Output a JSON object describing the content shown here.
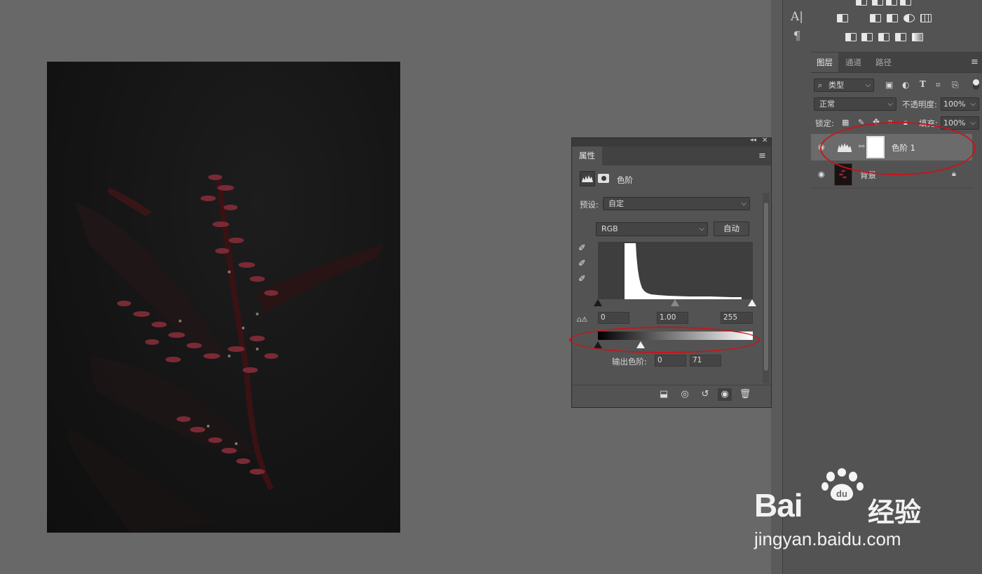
{
  "dock_strip": {
    "icon_1": "A|",
    "icon_2": "¶"
  },
  "layers_panel": {
    "tabs": [
      "图层",
      "通道",
      "路径"
    ],
    "filter": "类型",
    "blend_mode": "正常",
    "opacity_label": "不透明度:",
    "opacity_value": "100%",
    "lock_label": "锁定:",
    "fill_label": "填充:",
    "fill_value": "100%",
    "layers": [
      {
        "name": "色阶 1",
        "selected": true
      },
      {
        "name": "背景",
        "selected": false,
        "locked": true
      }
    ]
  },
  "properties_panel": {
    "tab": "属性",
    "adjustment_name": "色阶",
    "preset_label": "预设:",
    "preset_value": "自定",
    "channel_value": "RGB",
    "auto_button": "自动",
    "input_black": "0",
    "input_gamma": "1.00",
    "input_white": "255",
    "output_label": "输出色阶:",
    "output_black": "0",
    "output_white": "71"
  },
  "watermark": {
    "brand": "Bai",
    "suffix": "经验",
    "url": "jingyan.baidu.com"
  },
  "colors": {
    "annotation_red": "#c4161c",
    "panel_bg": "#535353",
    "canvas_bg": "#686868"
  }
}
